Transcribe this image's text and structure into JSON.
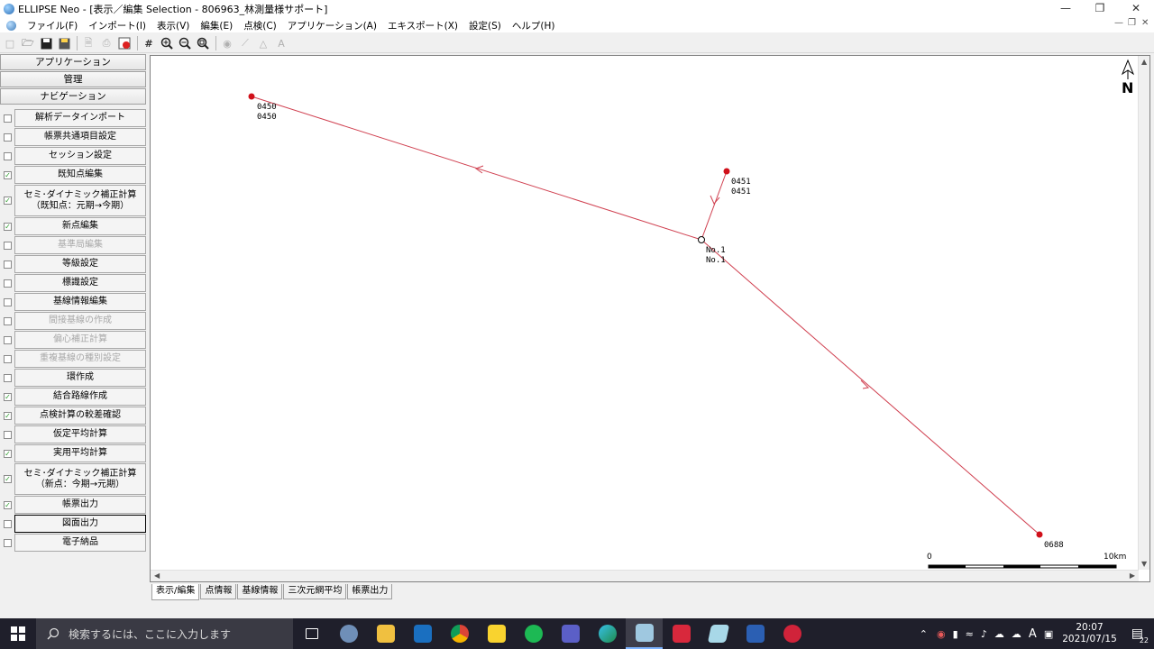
{
  "window": {
    "title": "ELLIPSE Neo - [表示／編集 Selection - 806963_林測量様サポート]"
  },
  "menu": [
    "ファイル(F)",
    "インポート(I)",
    "表示(V)",
    "編集(E)",
    "点検(C)",
    "アプリケーション(A)",
    "エキスポート(X)",
    "設定(S)",
    "ヘルプ(H)"
  ],
  "toolbar": {
    "icons": [
      "new-file-icon",
      "open-folder-icon",
      "save-icon",
      "save-as-icon",
      "print-preview-icon",
      "print-icon",
      "export-icon",
      "grid-icon",
      "zoom-in-icon",
      "zoom-out-icon",
      "zoom-fit-icon",
      "point-tool-icon",
      "line-tool-icon",
      "triangle-tool-icon",
      "text-tool-icon"
    ]
  },
  "sidebar": {
    "headers": [
      "アプリケーション",
      "管理",
      "ナビゲーション"
    ],
    "items": [
      {
        "label": "解析データインポート",
        "checked": false,
        "enabled": true
      },
      {
        "label": "帳票共通項目設定",
        "checked": false,
        "enabled": true
      },
      {
        "label": "セッション設定",
        "checked": false,
        "enabled": true
      },
      {
        "label": "既知点編集",
        "checked": true,
        "enabled": true
      },
      {
        "label": "セミ･ダイナミック補正計算",
        "label2": "（既知点：元期→今期）",
        "checked": true,
        "enabled": true
      },
      {
        "label": "新点編集",
        "checked": true,
        "enabled": true
      },
      {
        "label": "基準局編集",
        "checked": false,
        "enabled": false
      },
      {
        "label": "等級設定",
        "checked": false,
        "enabled": true
      },
      {
        "label": "標識設定",
        "checked": false,
        "enabled": true
      },
      {
        "label": "基線情報編集",
        "checked": false,
        "enabled": true
      },
      {
        "label": "間接基線の作成",
        "checked": false,
        "enabled": false
      },
      {
        "label": "偏心補正計算",
        "checked": false,
        "enabled": false
      },
      {
        "label": "重複基線の種別設定",
        "checked": false,
        "enabled": false
      },
      {
        "label": "環作成",
        "checked": false,
        "enabled": true
      },
      {
        "label": "結合路線作成",
        "checked": true,
        "enabled": true
      },
      {
        "label": "点検計算の較差確認",
        "checked": true,
        "enabled": true
      },
      {
        "label": "仮定平均計算",
        "checked": false,
        "enabled": true
      },
      {
        "label": "実用平均計算",
        "checked": true,
        "enabled": true
      },
      {
        "label": "セミ･ダイナミック補正計算",
        "label2": "（新点：今期→元期）",
        "checked": true,
        "enabled": true
      },
      {
        "label": "帳票出力",
        "checked": true,
        "enabled": true
      },
      {
        "label": "図面出力",
        "checked": false,
        "enabled": true,
        "focused": true
      },
      {
        "label": "電子納品",
        "checked": false,
        "enabled": true
      }
    ]
  },
  "map": {
    "points": [
      {
        "id": "p0450",
        "label1": "0450",
        "label2": "0450",
        "type": "known"
      },
      {
        "id": "p0451",
        "label1": "0451",
        "label2": "0451",
        "type": "known"
      },
      {
        "id": "pNo1",
        "label1": "No.1",
        "label2": "No.1",
        "type": "new"
      },
      {
        "id": "p0688",
        "label1": "0688",
        "label2": "",
        "type": "known"
      }
    ],
    "north_label": "N",
    "scale": {
      "start": "0",
      "end": "10km"
    },
    "line_color": "#d04050",
    "point_color": "#d0101a"
  },
  "tabs": [
    "表示/編集",
    "点情報",
    "基線情報",
    "三次元網平均",
    "帳票出力"
  ],
  "taskbar": {
    "search_placeholder": "検索するには、ここに入力します",
    "time": "20:07",
    "date": "2021/07/15",
    "notification_count": "22",
    "ime": "A"
  }
}
